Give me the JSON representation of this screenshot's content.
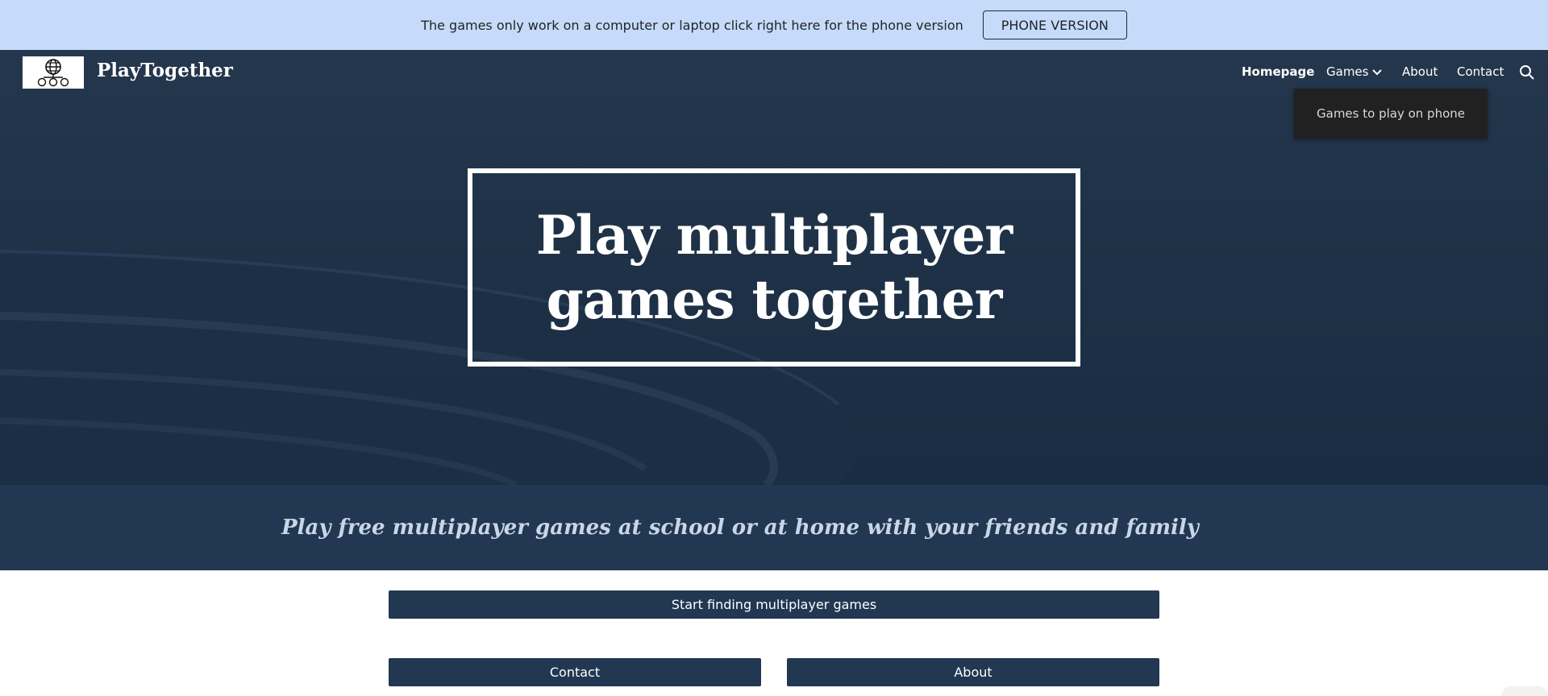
{
  "banner": {
    "text": "The games only work on a computer or laptop click right here for the phone version",
    "button_label": "PHONE VERSION"
  },
  "header": {
    "site_title": "PlayTogether",
    "logo_icon": "globe-controllers-icon",
    "nav": [
      {
        "label": "Homepage",
        "active": true
      },
      {
        "label": "Games",
        "has_dropdown": true
      },
      {
        "label": "About"
      },
      {
        "label": "Contact"
      }
    ],
    "search_icon": "search-icon",
    "dropdown": {
      "items": [
        "Games to play on phone"
      ]
    }
  },
  "hero": {
    "title_line1": "Play multiplayer",
    "title_line2": "games together"
  },
  "tagline": "Play free multiplayer games at school or at home with your friends and family",
  "buttons": {
    "start": "Start finding multiplayer games",
    "contact": "Contact",
    "about": "About"
  },
  "colors": {
    "banner_bg": "#c5dbf9",
    "hero_bg": "#1f3247",
    "band_bg": "#223752",
    "button_bg": "#223752",
    "dropdown_bg": "#212121"
  }
}
